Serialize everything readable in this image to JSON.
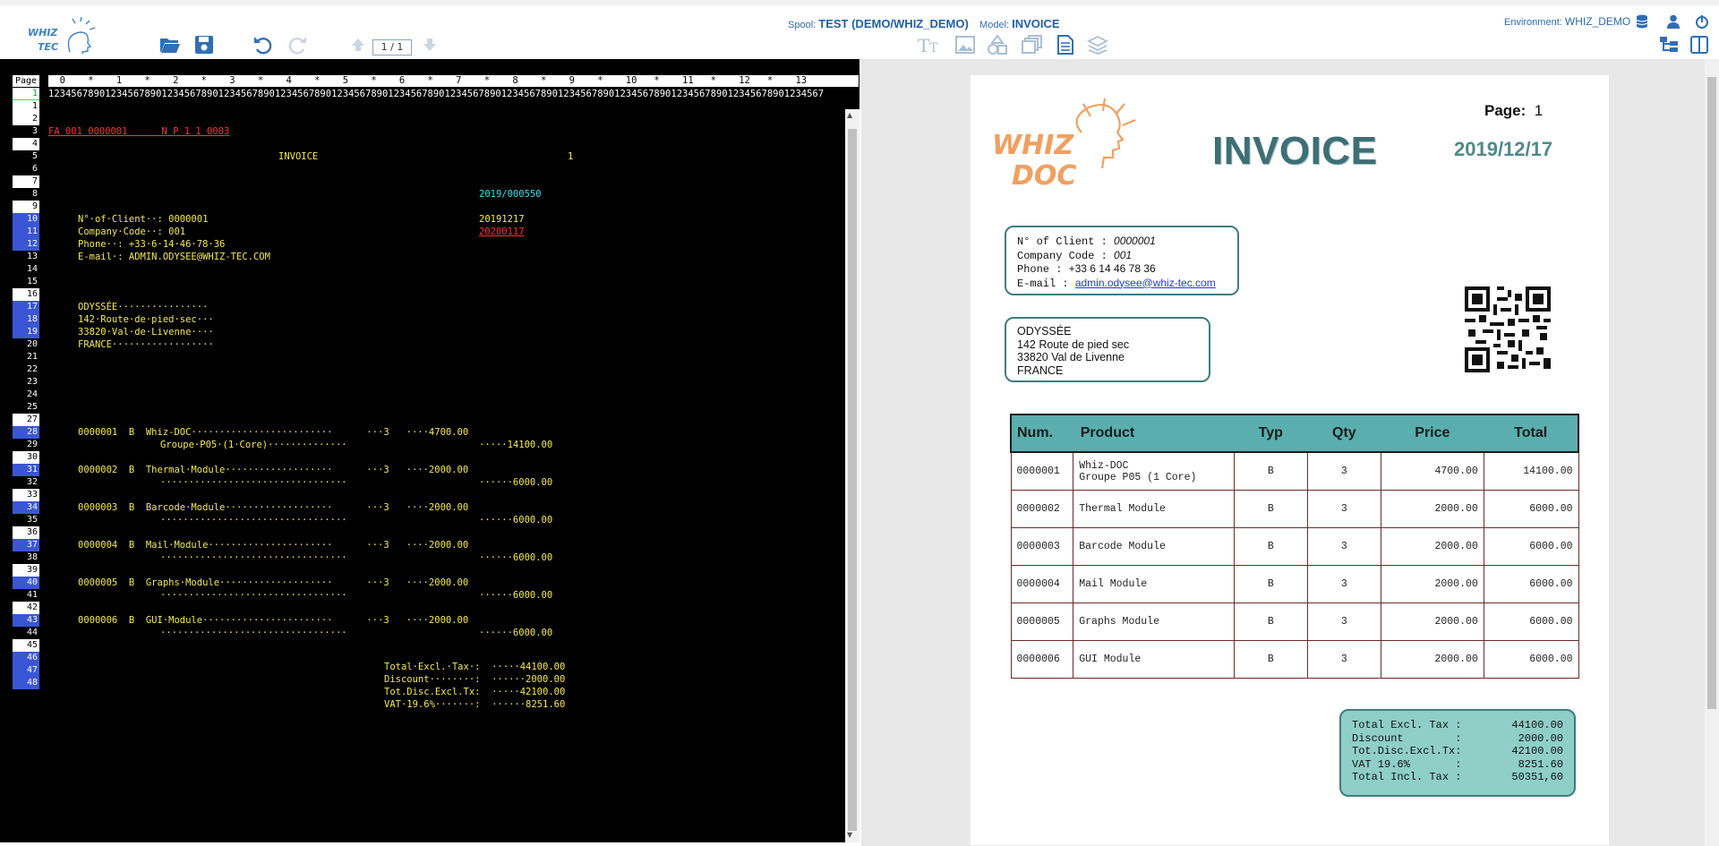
{
  "header": {
    "logo_text_top": "WHIZ",
    "logo_text_bottom": "TEC",
    "pager": "1 / 1",
    "spool_label": "Spool:",
    "spool_value": "TEST (DEMO/WHIZ_DEMO)",
    "model_label": "Model:",
    "model_value": "INVOICE",
    "env_label": "Environment:",
    "env_value": "WHIZ_DEMO"
  },
  "spool": {
    "page_label": "Page",
    "ruler_top": "  0    *    1    *    2    *    3    *    4    *    5    *    6    *    7    *    8    *    9    *    10   *    11   *    12   *    13",
    "ruler_digits": "12345678901234567890123456789012345678901234567890123456789012345678901234567890123456789012345678901234567890123456789012345678901234567",
    "lines": [
      {
        "n": "1",
        "s": "w"
      },
      {
        "n": "2",
        "s": "w"
      },
      {
        "n": "3",
        "s": "k"
      },
      {
        "n": "4",
        "s": "w"
      },
      {
        "n": "5",
        "s": "k"
      },
      {
        "n": "6",
        "s": "k"
      },
      {
        "n": "7",
        "s": "w"
      },
      {
        "n": "8",
        "s": "k"
      },
      {
        "n": "9",
        "s": "w"
      },
      {
        "n": "10",
        "s": "b"
      },
      {
        "n": "11",
        "s": "b"
      },
      {
        "n": "12",
        "s": "b"
      },
      {
        "n": "13",
        "s": "k"
      },
      {
        "n": "14",
        "s": "k"
      },
      {
        "n": "15",
        "s": "k"
      },
      {
        "n": "16",
        "s": "w"
      },
      {
        "n": "17",
        "s": "b"
      },
      {
        "n": "18",
        "s": "b"
      },
      {
        "n": "19",
        "s": "b"
      },
      {
        "n": "20",
        "s": "k"
      },
      {
        "n": "21",
        "s": "k"
      },
      {
        "n": "22",
        "s": "k"
      },
      {
        "n": "23",
        "s": "k"
      },
      {
        "n": "24",
        "s": "k"
      },
      {
        "n": "25",
        "s": "k"
      },
      {
        "n": "27",
        "s": "w"
      },
      {
        "n": "28",
        "s": "b"
      },
      {
        "n": "29",
        "s": "k"
      },
      {
        "n": "30",
        "s": "w"
      },
      {
        "n": "31",
        "s": "b"
      },
      {
        "n": "32",
        "s": "k"
      },
      {
        "n": "33",
        "s": "w"
      },
      {
        "n": "34",
        "s": "b"
      },
      {
        "n": "35",
        "s": "k"
      },
      {
        "n": "36",
        "s": "w"
      },
      {
        "n": "37",
        "s": "b"
      },
      {
        "n": "38",
        "s": "k"
      },
      {
        "n": "39",
        "s": "w"
      },
      {
        "n": "40",
        "s": "b"
      },
      {
        "n": "41",
        "s": "k"
      },
      {
        "n": "42",
        "s": "w"
      },
      {
        "n": "43",
        "s": "b"
      },
      {
        "n": "44",
        "s": "k"
      },
      {
        "n": "45",
        "s": "w"
      },
      {
        "n": "46",
        "s": "b"
      },
      {
        "n": "47",
        "s": "b"
      },
      {
        "n": "48",
        "s": "b"
      }
    ],
    "l1": "FA 001 0000001      N P 1 1 0003",
    "invoice": "INVOICE",
    "page_no": "1",
    "ref": "2019/000550",
    "client": "N°·of·Client··: 0000001",
    "date1": "20191217",
    "company": "Company·Code··: 001",
    "date2": "20200117",
    "phone": "Phone··: +33·6·14·46·78·36",
    "email": "E-mail·: ADMIN.ODYSEE@WHIZ-TEC.COM",
    "addr1": "ODYSSÉE················",
    "addr2": "142·Route·de·pied·sec···",
    "addr3": "33820·Val·de·Livenne····",
    "addr4": "FRANCE··················",
    "item_rows": [
      {
        "a": "0000001  B  Whiz-DOC·························      ···3   ····4700.00",
        "b": "Groupe·P05·(1·Core)··············",
        "t": "·····14100.00"
      },
      {
        "a": "0000002  B  Thermal·Module···················      ···3   ····2000.00",
        "b": "·································",
        "t": "······6000.00"
      },
      {
        "a": "0000003  B  Barcode·Module···················      ···3   ····2000.00",
        "b": "·································",
        "t": "······6000.00"
      },
      {
        "a": "0000004  B  Mail·Module······················      ···3   ····2000.00",
        "b": "·································",
        "t": "······6000.00"
      },
      {
        "a": "0000005  B  Graphs·Module····················      ···3   ····2000.00",
        "b": "·································",
        "t": "······6000.00"
      },
      {
        "a": "0000006  B  GUI·Module·······················      ···3   ····2000.00",
        "b": "·································",
        "t": "······6000.00"
      }
    ],
    "tot1": "Total·Excl.·Tax·:  ·····44100.00",
    "tot2": "Discount········:  ······2000.00",
    "tot3": "Tot.Disc.Excl.Tx:  ·····42100.00",
    "tot4": "VAT·19.6%·······:  ······8251.60"
  },
  "preview": {
    "logo_top": "WHIZ",
    "logo_bottom": "DOC",
    "title": "INVOICE",
    "page_label": "Page:",
    "page_value": "1",
    "date": "2019/12/17",
    "client_no_label": "N° of Client  : ",
    "client_no": "0000001",
    "company_label": "Company Code  : ",
    "company": "001",
    "phone_label": "Phone  : ",
    "phone": "+33 6 14 46 78 36",
    "email_label": "E-mail : ",
    "email": "admin.odysee@whiz-tec.com",
    "addr1": "ODYSSÉE",
    "addr2": "142 Route de pied sec",
    "addr3": "33820 Val de Livenne",
    "addr4": "FRANCE",
    "columns": [
      "Num.",
      "Product",
      "Typ",
      "Qty",
      "Price",
      "Total"
    ],
    "rows": [
      {
        "num": "0000001",
        "product": "Whiz-DOC",
        "product2": "Groupe P05 (1 Core)",
        "typ": "B",
        "qty": "3",
        "price": "4700.00",
        "total": "14100.00"
      },
      {
        "num": "0000002",
        "product": "Thermal Module",
        "product2": "",
        "typ": "B",
        "qty": "3",
        "price": "2000.00",
        "total": "6000.00"
      },
      {
        "num": "0000003",
        "product": "Barcode Module",
        "product2": "",
        "typ": "B",
        "qty": "3",
        "price": "2000.00",
        "total": "6000.00"
      },
      {
        "num": "0000004",
        "product": "Mail Module",
        "product2": "",
        "typ": "B",
        "qty": "3",
        "price": "2000.00",
        "total": "6000.00"
      },
      {
        "num": "0000005",
        "product": "Graphs Module",
        "product2": "",
        "typ": "B",
        "qty": "3",
        "price": "2000.00",
        "total": "6000.00"
      },
      {
        "num": "0000006",
        "product": "GUI Module",
        "product2": "",
        "typ": "B",
        "qty": "3",
        "price": "2000.00",
        "total": "6000.00"
      }
    ],
    "totals": [
      {
        "label": "Total Excl. Tax :",
        "value": "44100.00"
      },
      {
        "label": "Discount        :",
        "value": "2000.00"
      },
      {
        "label": "Tot.Disc.Excl.Tx:",
        "value": "42100.00"
      },
      {
        "label": "VAT 19.6%       :",
        "value": "8251.60"
      },
      {
        "label": "Total Incl. Tax :",
        "value": "50351,60"
      }
    ]
  },
  "colors": {
    "accent": "#1e5fa8",
    "teal": "#3e7c82",
    "orange": "#f0a060",
    "spool_text": "#f5e94c"
  }
}
